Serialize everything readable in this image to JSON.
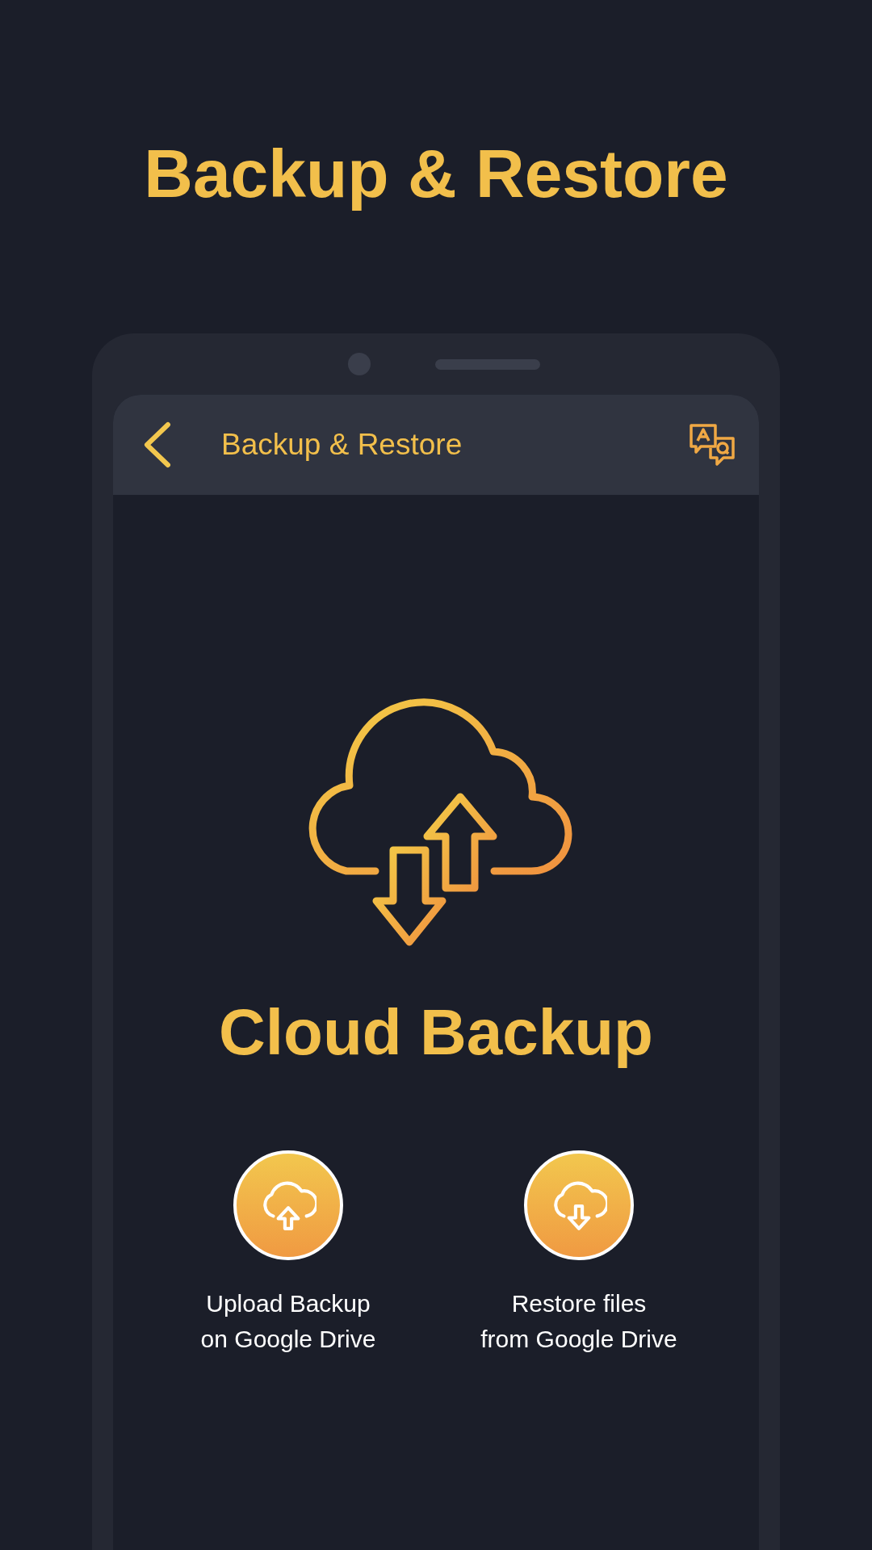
{
  "headline": "Backup & Restore",
  "app_bar": {
    "title": "Backup & Restore"
  },
  "hero": {
    "title": "Cloud Backup"
  },
  "actions": [
    {
      "kind": "upload",
      "label": "Upload Backup\non Google Drive"
    },
    {
      "kind": "download",
      "label": "Restore files\nfrom Google Drive"
    }
  ]
}
